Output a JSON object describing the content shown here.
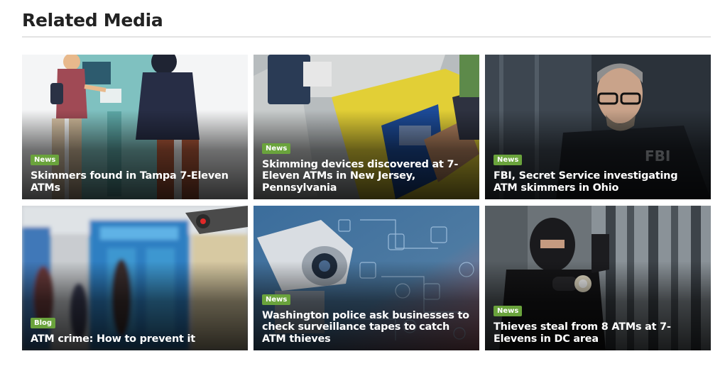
{
  "section": {
    "heading": "Related Media"
  },
  "cards": [
    {
      "tag": "News",
      "title": "Skimmers found in Tampa 7-Eleven ATMs"
    },
    {
      "tag": "News",
      "title": "Skimming devices discovered at 7-Eleven ATMs in New Jersey, Pennsylvania"
    },
    {
      "tag": "News",
      "title": "FBI, Secret Service investigating ATM skimmers in Ohio"
    },
    {
      "tag": "Blog",
      "title": "ATM crime: How to prevent it"
    },
    {
      "tag": "News",
      "title": "Washington police ask businesses to check surveillance tapes to catch ATM thieves"
    },
    {
      "tag": "News",
      "title": "Thieves steal from 8 ATMs at 7-Elevens in DC area"
    }
  ],
  "theme": {
    "badge_color": "#6aa33c",
    "heading_color": "#222222"
  }
}
